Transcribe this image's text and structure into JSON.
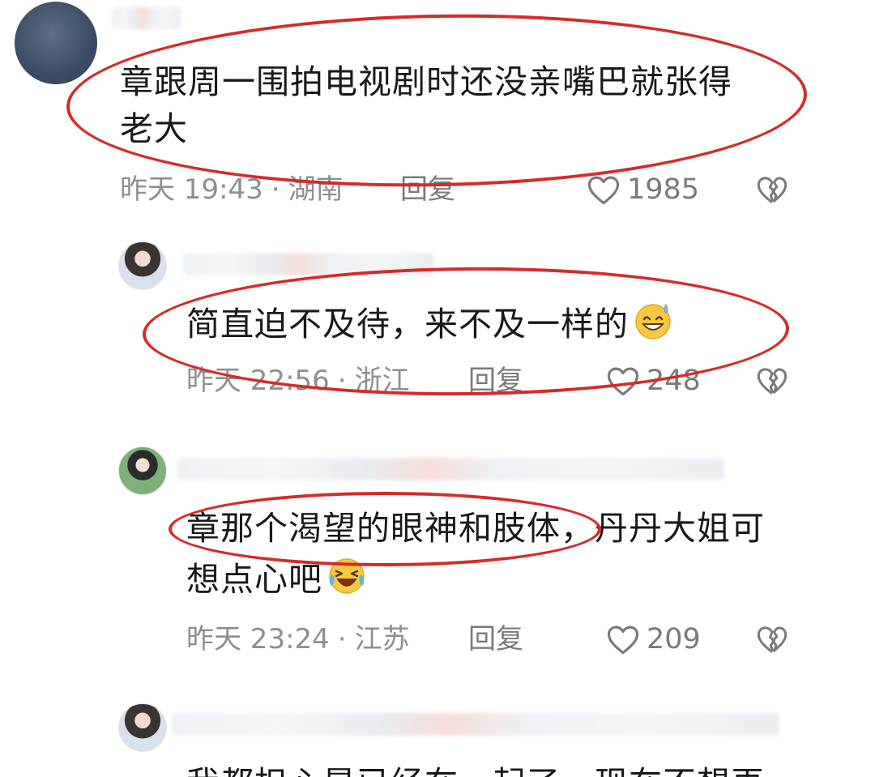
{
  "comments": [
    {
      "text_lines": [
        "章跟周一围拍电视剧时还没亲嘴巴就张得",
        "老大"
      ],
      "time": "昨天 19:43",
      "location": "湖南",
      "reply_label": "回复",
      "likes": "1985"
    },
    {
      "text_lines": [
        "简直迫不及待，来不及一样的"
      ],
      "time": "昨天 22:56",
      "location": "浙江",
      "reply_label": "回复",
      "likes": "248",
      "emoji": "sweat-smile-emoji"
    },
    {
      "text_lines": [
        "章那个渴望的眼神和肢体，丹丹大姐可",
        "想点心吧"
      ],
      "time": "昨天 23:24",
      "location": "江苏",
      "reply_label": "回复",
      "likes": "209",
      "emoji": "laughing-tears-emoji"
    },
    {
      "text_lines": [
        "我都担心是已经在一起了，现在不想再"
      ]
    }
  ],
  "icons": {
    "like": "heart-outline-icon",
    "dislike": "broken-heart-icon"
  },
  "colors": {
    "annotation": "#d62a2a",
    "meta": "#8f8f8f"
  }
}
